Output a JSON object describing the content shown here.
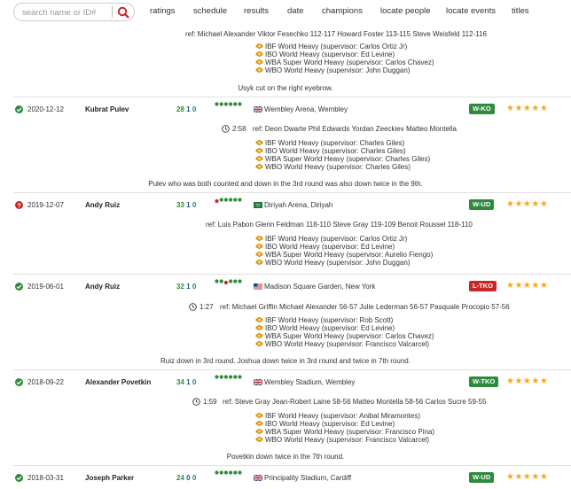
{
  "search": {
    "placeholder": "search name or ID#"
  },
  "nav": [
    "ratings",
    "schedule",
    "results",
    "date",
    "champions",
    "locate people",
    "locate events",
    "titles"
  ],
  "top_partial": {
    "refs": "ref: Michael Alexander    Viktor Fesechko 112-117    Howard Foster 113-115    Steve Weisfeld 112-116",
    "titles": [
      "IBF World Heavy (supervisor: Carlos Ortiz Jr)",
      "IBO World Heavy (supervisor: Ed Levine)",
      "WBA Super World Heavy (supervisor: Carlos Chavez)",
      "WBO World Heavy (supervisor: John Duggan)"
    ],
    "note": "Usyk cut on the right eyebrow."
  },
  "bouts": [
    {
      "status": "verified",
      "date": "2020-12-12",
      "opponent": "Kubrat Pulev",
      "w": "28",
      "l": "1",
      "d": "0",
      "streak": [
        "w",
        "w",
        "w",
        "w",
        "w",
        "w"
      ],
      "venue": "Wembley Arena, Wembley",
      "flag": "gb",
      "result": "W-KO",
      "result_type": "win",
      "stars": "★★★★★",
      "time": "2:58",
      "refs": "ref: Deon Dwarte    Phil Edwards    Yordan Zeeckiev    Matteo Montella",
      "titles": [
        "IBF World Heavy (supervisor: Charles Giles)",
        "IBO World Heavy (supervisor: Charles Giles)",
        "WBA Super World Heavy (supervisor: Charles Giles)",
        "WBO World Heavy (supervisor: Charles Giles)"
      ],
      "note": "Pulev who was both counted and down in the 3rd round was also down twice in the 9th."
    },
    {
      "status": "unverified",
      "date": "2019-12-07",
      "opponent": "Andy Ruiz",
      "w": "33",
      "l": "1",
      "d": "0",
      "streak": [
        "l",
        "w",
        "w",
        "w",
        "w",
        "w"
      ],
      "venue": "Diriyah Arena, Diriyah",
      "flag": "sa",
      "result": "W-UD",
      "result_type": "win",
      "stars": "★★★★★",
      "time": "",
      "refs": "ref: Luis Pabon    Glenn Feldman 118-110    Steve Gray 119-109    Benoit Roussel 118-110",
      "titles": [
        "IBF World Heavy (supervisor: Carlos Ortiz Jr)",
        "IBO World Heavy (supervisor: Ed Levine)",
        "WBA Super World Heavy (supervisor: Aurelio Fiengo)",
        "WBO World Heavy (supervisor: John Duggan)"
      ],
      "note": ""
    },
    {
      "status": "verified",
      "date": "2019-06-01",
      "opponent": "Andy Ruiz",
      "w": "32",
      "l": "1",
      "d": "0",
      "streak": [
        "w",
        "w",
        "l",
        "w",
        "w",
        "w"
      ],
      "venue": "Madison Square Garden, New York",
      "flag": "us",
      "result": "L-TKO",
      "result_type": "loss",
      "stars": "★★★★★",
      "time": "1:27",
      "refs": "ref: Michael Griffin    Michael Alexander 56-57    Julie Lederman 56-57    Pasquale Procopio 57-56",
      "titles": [
        "IBF World Heavy (supervisor: Rob Scott)",
        "IBO World Heavy (supervisor: Ed Levine)",
        "WBA Super World Heavy (supervisor: Carlos Chavez)",
        "WBO World Heavy (supervisor: Francisco Valcarcel)"
      ],
      "note": "Ruiz down in 3rd round. Joshua down twice in 3rd round and twice in 7th round."
    },
    {
      "status": "verified",
      "date": "2018-09-22",
      "opponent": "Alexander Povetkin",
      "w": "34",
      "l": "1",
      "d": "0",
      "streak": [
        "w",
        "w",
        "w",
        "w",
        "w",
        "w"
      ],
      "venue": "Wembley Stadium, Wembley",
      "flag": "gb",
      "result": "W-TKO",
      "result_type": "win",
      "stars": "★★★★★",
      "time": "1:59",
      "refs": "ref: Steve Gray    Jean-Robert Laine 58-56    Matteo Montella 58-56    Carlos Sucre 59-55",
      "titles": [
        "IBF World Heavy (supervisor: Anibal Miramontes)",
        "IBO World Heavy (supervisor: Ed Levine)",
        "WBA Super World Heavy (supervisor: Francisco Pina)",
        "WBO World Heavy (supervisor: Francisco Valcarcel)"
      ],
      "note": "Povetkin down twice in the 7th round."
    },
    {
      "status": "verified",
      "date": "2018-03-31",
      "opponent": "Joseph Parker",
      "w": "24",
      "l": "0",
      "d": "0",
      "streak": [
        "w",
        "w",
        "w",
        "w",
        "w",
        "w"
      ],
      "venue": "Principality Stadium, Cardiff",
      "flag": "gb",
      "result": "W-UD",
      "result_type": "win",
      "stars": "★★★★★",
      "time": "",
      "refs": "",
      "titles": [],
      "note": ""
    }
  ],
  "colors": {
    "win": "#2e8b3d",
    "loss": "#c62828",
    "star": "#f5a623",
    "belt": "#e8a317",
    "search_icon": "#c62828"
  }
}
